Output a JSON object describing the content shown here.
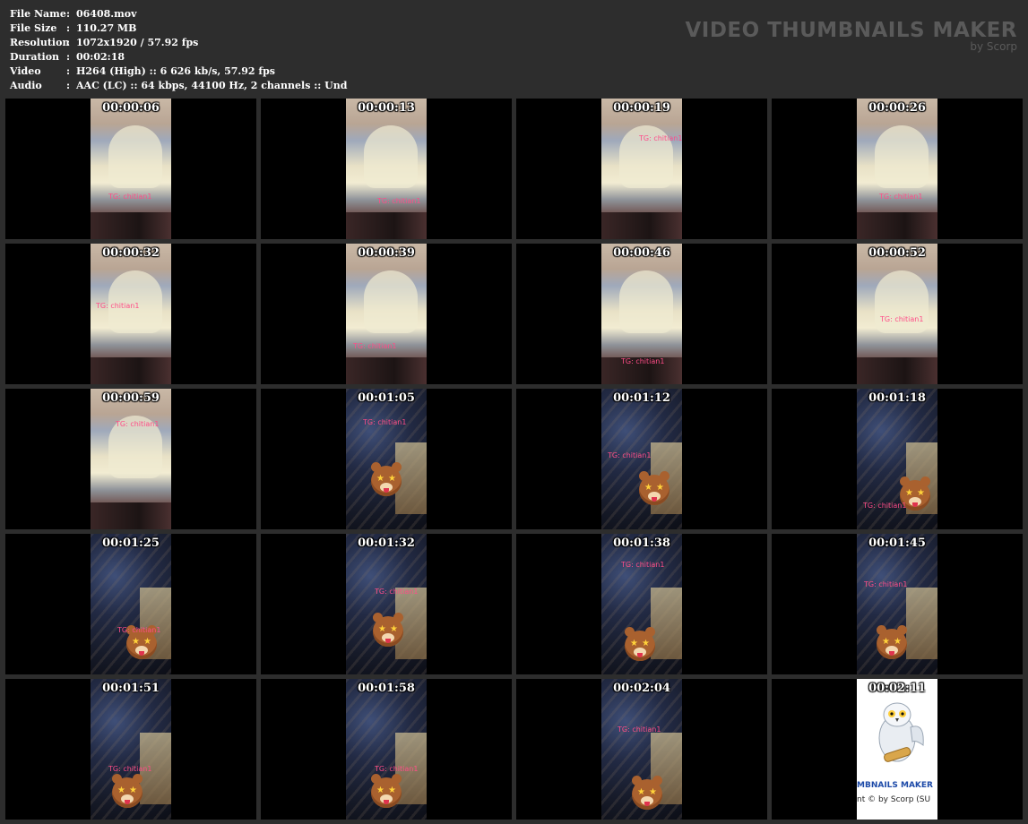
{
  "info": [
    {
      "label": "File Name",
      "sep": ":",
      "value": "06408.mov"
    },
    {
      "label": "File Size",
      "sep": ":",
      "value": "110.27 MB"
    },
    {
      "label": "Resolution",
      "sep": ":",
      "value": "1072x1920 / 57.92 fps"
    },
    {
      "label": "Duration",
      "sep": ":",
      "value": "00:02:18"
    },
    {
      "label": "Video",
      "sep": ":",
      "value": "H264 (High) :: 6 626 kb/s, 57.92 fps"
    },
    {
      "label": "Audio",
      "sep": ":",
      "value": "AAC (LC) :: 64 kbps, 44100 Hz, 2 channels :: Und"
    }
  ],
  "brand": {
    "title": "VIDEO THUMBNAILS MAKER",
    "subtitle": "by Scorp"
  },
  "watermark_text": "TG:  chitian1",
  "promo": {
    "line1": "MBNAILS MAKER",
    "line2": "nt © by Scorp (SU"
  },
  "thumbnails": [
    {
      "time": "00:00:06",
      "style": "bright",
      "bear": false
    },
    {
      "time": "00:00:13",
      "style": "bright",
      "bear": false
    },
    {
      "time": "00:00:19",
      "style": "bright",
      "bear": false
    },
    {
      "time": "00:00:26",
      "style": "bright",
      "bear": false
    },
    {
      "time": "00:00:32",
      "style": "bright",
      "bear": false
    },
    {
      "time": "00:00:39",
      "style": "bright",
      "bear": false
    },
    {
      "time": "00:00:46",
      "style": "bright",
      "bear": false
    },
    {
      "time": "00:00:52",
      "style": "bright",
      "bear": false
    },
    {
      "time": "00:00:59",
      "style": "bright",
      "bear": false
    },
    {
      "time": "00:01:05",
      "style": "dark",
      "bear": true
    },
    {
      "time": "00:01:12",
      "style": "dark",
      "bear": true
    },
    {
      "time": "00:01:18",
      "style": "dark",
      "bear": true
    },
    {
      "time": "00:01:25",
      "style": "dark",
      "bear": true
    },
    {
      "time": "00:01:32",
      "style": "dark",
      "bear": true
    },
    {
      "time": "00:01:38",
      "style": "dark",
      "bear": true
    },
    {
      "time": "00:01:45",
      "style": "dark",
      "bear": true
    },
    {
      "time": "00:01:51",
      "style": "dark",
      "bear": true
    },
    {
      "time": "00:01:58",
      "style": "dark",
      "bear": true
    },
    {
      "time": "00:02:04",
      "style": "dark",
      "bear": true
    },
    {
      "time": "00:02:11",
      "style": "promo",
      "bear": false
    }
  ]
}
